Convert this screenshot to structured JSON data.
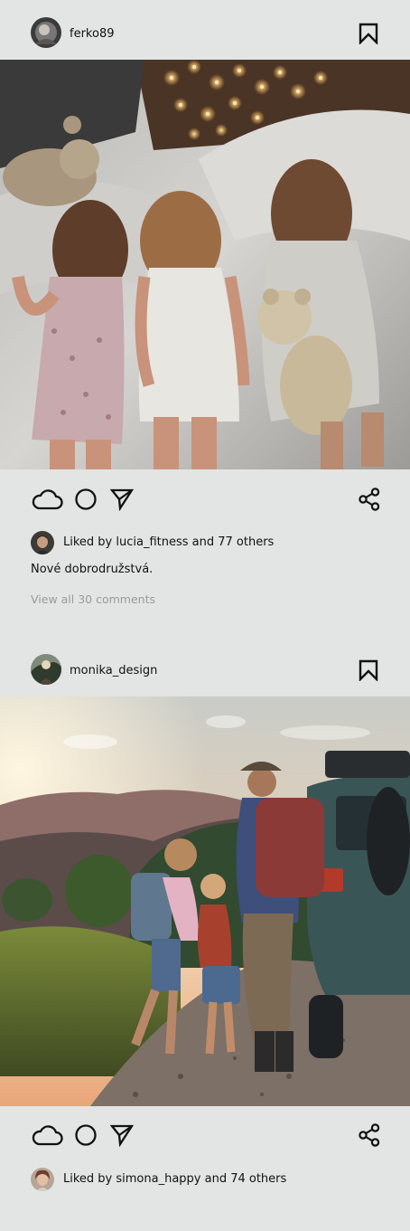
{
  "posts": [
    {
      "username": "ferko89",
      "photo_description": "Three children lying on a bed with teddy bears and fairy lights",
      "liked_by_text": "Liked by lucia_fitness and 77 others",
      "caption": "Nové dobrodružstvá.",
      "comments_link": "View all 30 comments",
      "icons": {
        "bookmark": "bookmark-icon",
        "like": "cloud-icon",
        "comment": "circle-icon",
        "send": "send-icon",
        "share": "share-icon"
      }
    },
    {
      "username": "monika_design",
      "photo_description": "Family with backpacks walking on a mountain trail at sunset next to an SUV",
      "liked_by_text": "Liked by simona_happy and 74 others",
      "icons": {
        "bookmark": "bookmark-icon",
        "like": "cloud-icon",
        "comment": "circle-icon",
        "send": "send-icon",
        "share": "share-icon"
      }
    }
  ],
  "colors": {
    "background": "#e2e5e4",
    "text": "#111111",
    "muted_text": "#9a9c9c"
  }
}
